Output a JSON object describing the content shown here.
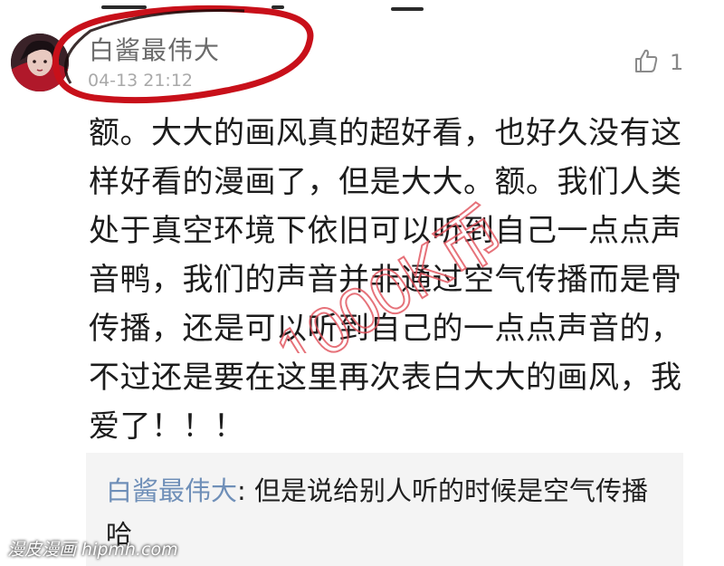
{
  "comment": {
    "username": "白酱最伟大",
    "timestamp": "04-13 21:12",
    "like_count": "1",
    "body_lines": [
      "额。大大的画风真的超好看，也好久没有这",
      "样好看的漫画了，但是大大。额。我们人类",
      "处于真空环境下依旧可以听到自己一点点声",
      "音鸭，我们的声音并非通过空气传播而是骨",
      "传播，还是可以听到自己的一点点声音的，",
      "不过还是要在这里再次表白大大的画风，我",
      "爱了！！！"
    ]
  },
  "reply": {
    "username": "白酱最伟大",
    "separator": ": ",
    "text": "但是说给别人听的时候是空气传播哈"
  },
  "watermarks": {
    "diagonal": "1000K币",
    "corner": "漫皮漫画 hipmh.com"
  },
  "colors": {
    "ring": "#c8101a",
    "watermark_diagonal": "#e0505a",
    "reply_name": "#6f8fb8"
  },
  "icons": {
    "like": "thumbs-up-icon"
  }
}
